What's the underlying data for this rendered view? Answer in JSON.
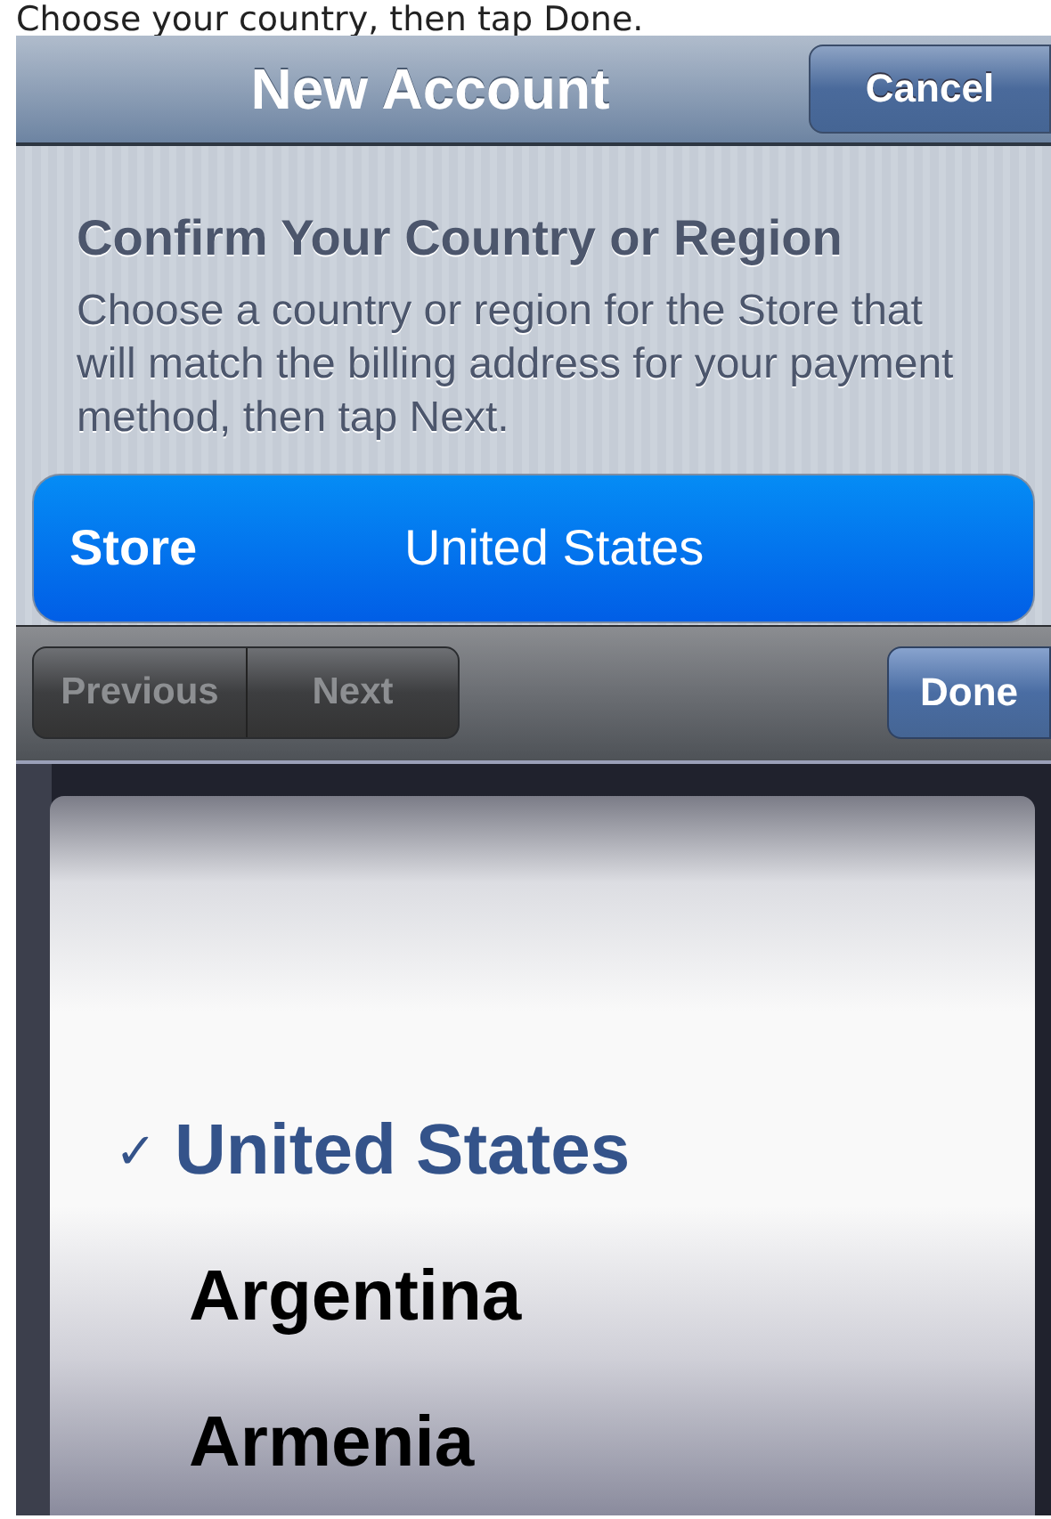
{
  "caption": "Choose your country, then tap Done.",
  "nav_bar": {
    "title": "New Account",
    "cancel_button": "Cancel"
  },
  "heading": "Confirm Your Country or Region",
  "description": "Choose a country or region for the Store that will match the billing address for your payment method, then tap Next.",
  "store_field": {
    "label": "Store",
    "value": "United States"
  },
  "toolbar": {
    "previous": {
      "label": "Previous",
      "disabled": true
    },
    "next": {
      "label": "Next",
      "disabled": true
    },
    "done": "Done"
  },
  "picker": {
    "check": "✓",
    "items": [
      {
        "label": "United States",
        "selected": true
      },
      {
        "label": "Argentina",
        "selected": false
      },
      {
        "label": "Armenia",
        "selected": false
      }
    ]
  }
}
